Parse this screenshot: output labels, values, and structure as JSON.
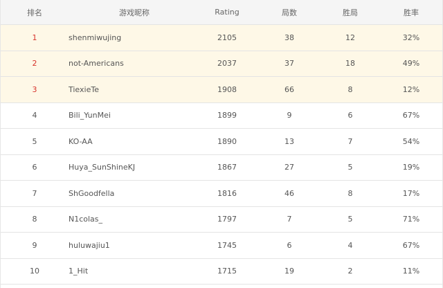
{
  "columns": {
    "rank": "排名",
    "name": "游戏昵称",
    "rating": "Rating",
    "games": "局数",
    "wins": "胜局",
    "win_rate": "胜率"
  },
  "rows": [
    {
      "rank": "1",
      "name": "shenmiwujing",
      "rating": "2105",
      "games": "38",
      "wins": "12",
      "win_rate": "32%"
    },
    {
      "rank": "2",
      "name": "not-Americans",
      "rating": "2037",
      "games": "37",
      "wins": "18",
      "win_rate": "49%"
    },
    {
      "rank": "3",
      "name": "TiexieTe",
      "rating": "1908",
      "games": "66",
      "wins": "8",
      "win_rate": "12%"
    },
    {
      "rank": "4",
      "name": "Bili_YunMei",
      "rating": "1899",
      "games": "9",
      "wins": "6",
      "win_rate": "67%"
    },
    {
      "rank": "5",
      "name": "KO-AA",
      "rating": "1890",
      "games": "13",
      "wins": "7",
      "win_rate": "54%"
    },
    {
      "rank": "6",
      "name": "Huya_SunShineKJ",
      "rating": "1867",
      "games": "27",
      "wins": "5",
      "win_rate": "19%"
    },
    {
      "rank": "7",
      "name": "ShGoodfella",
      "rating": "1816",
      "games": "46",
      "wins": "8",
      "win_rate": "17%"
    },
    {
      "rank": "8",
      "name": "N1colas_",
      "rating": "1797",
      "games": "7",
      "wins": "5",
      "win_rate": "71%"
    },
    {
      "rank": "9",
      "name": "huluwajiu1",
      "rating": "1745",
      "games": "6",
      "wins": "4",
      "win_rate": "67%"
    },
    {
      "rank": "10",
      "name": "1_Hit",
      "rating": "1715",
      "games": "19",
      "wins": "2",
      "win_rate": "11%"
    }
  ],
  "colors": {
    "top_rank_text": "#d6322b",
    "top_row_background": "#fef8e7",
    "header_background": "#f5f5f5",
    "border": "#e4e4e4"
  }
}
